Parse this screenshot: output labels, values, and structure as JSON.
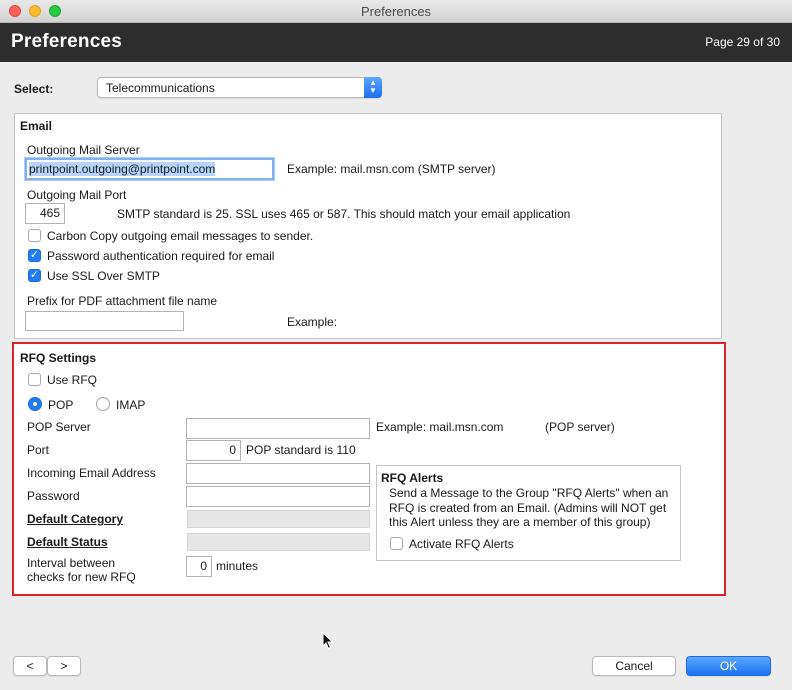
{
  "window": {
    "title": "Preferences"
  },
  "header": {
    "title": "Preferences",
    "page_indicator": "Page 29 of 30"
  },
  "select": {
    "label": "Select:",
    "value": "Telecommunications"
  },
  "email": {
    "title": "Email",
    "outgoing_server_label": "Outgoing Mail Server",
    "outgoing_server_value": "printpoint.outgoing@printpoint.com",
    "outgoing_server_example": "Example: mail.msn.com (SMTP server)",
    "port_label": "Outgoing Mail Port",
    "port_value": "465",
    "port_note": "SMTP standard is 25. SSL uses 465 or 587. This should match your email application",
    "cc_label": "Carbon Copy outgoing email messages to sender.",
    "cc_checked": false,
    "auth_label": "Password authentication required for email",
    "auth_checked": true,
    "ssl_label": "Use SSL Over SMTP",
    "ssl_checked": true,
    "prefix_label": "Prefix for PDF attachment file name",
    "prefix_value": "",
    "prefix_example": "Example:"
  },
  "rfq": {
    "title": "RFQ Settings",
    "use_rfq_label": "Use RFQ",
    "use_rfq_checked": false,
    "pop_label": "POP",
    "imap_label": "IMAP",
    "protocol_selected": "POP",
    "pop_server_label": "POP Server",
    "pop_server_value": "",
    "pop_server_example": "Example: mail.msn.com",
    "pop_server_hint": "(POP server)",
    "port_label": "Port",
    "port_value": "0",
    "port_note": "POP standard is 110",
    "incoming_label": "Incoming Email Address",
    "incoming_value": "",
    "password_label": "Password",
    "password_value": "",
    "default_category_label": "Default Category",
    "default_status_label": "Default Status",
    "interval_label_line1": "Interval between",
    "interval_label_line2": "checks for new RFQ",
    "interval_value": "0",
    "interval_unit": "minutes",
    "alerts": {
      "title": "RFQ Alerts",
      "desc_line1": "Send a Message to the Group \"RFQ Alerts\" when an",
      "desc_line2": "RFQ is created from an Email. (Admins will NOT get",
      "desc_line3": "this Alert unless they are a member of this group)",
      "activate_label": "Activate RFQ Alerts",
      "activate_checked": false
    }
  },
  "footer": {
    "prev_label": "<",
    "next_label": ">",
    "cancel_label": "Cancel",
    "ok_label": "OK"
  },
  "colors": {
    "header_bg": "#2d2d2d",
    "accent_blue": "#1f7cf5",
    "highlight_red": "#d9232d"
  }
}
